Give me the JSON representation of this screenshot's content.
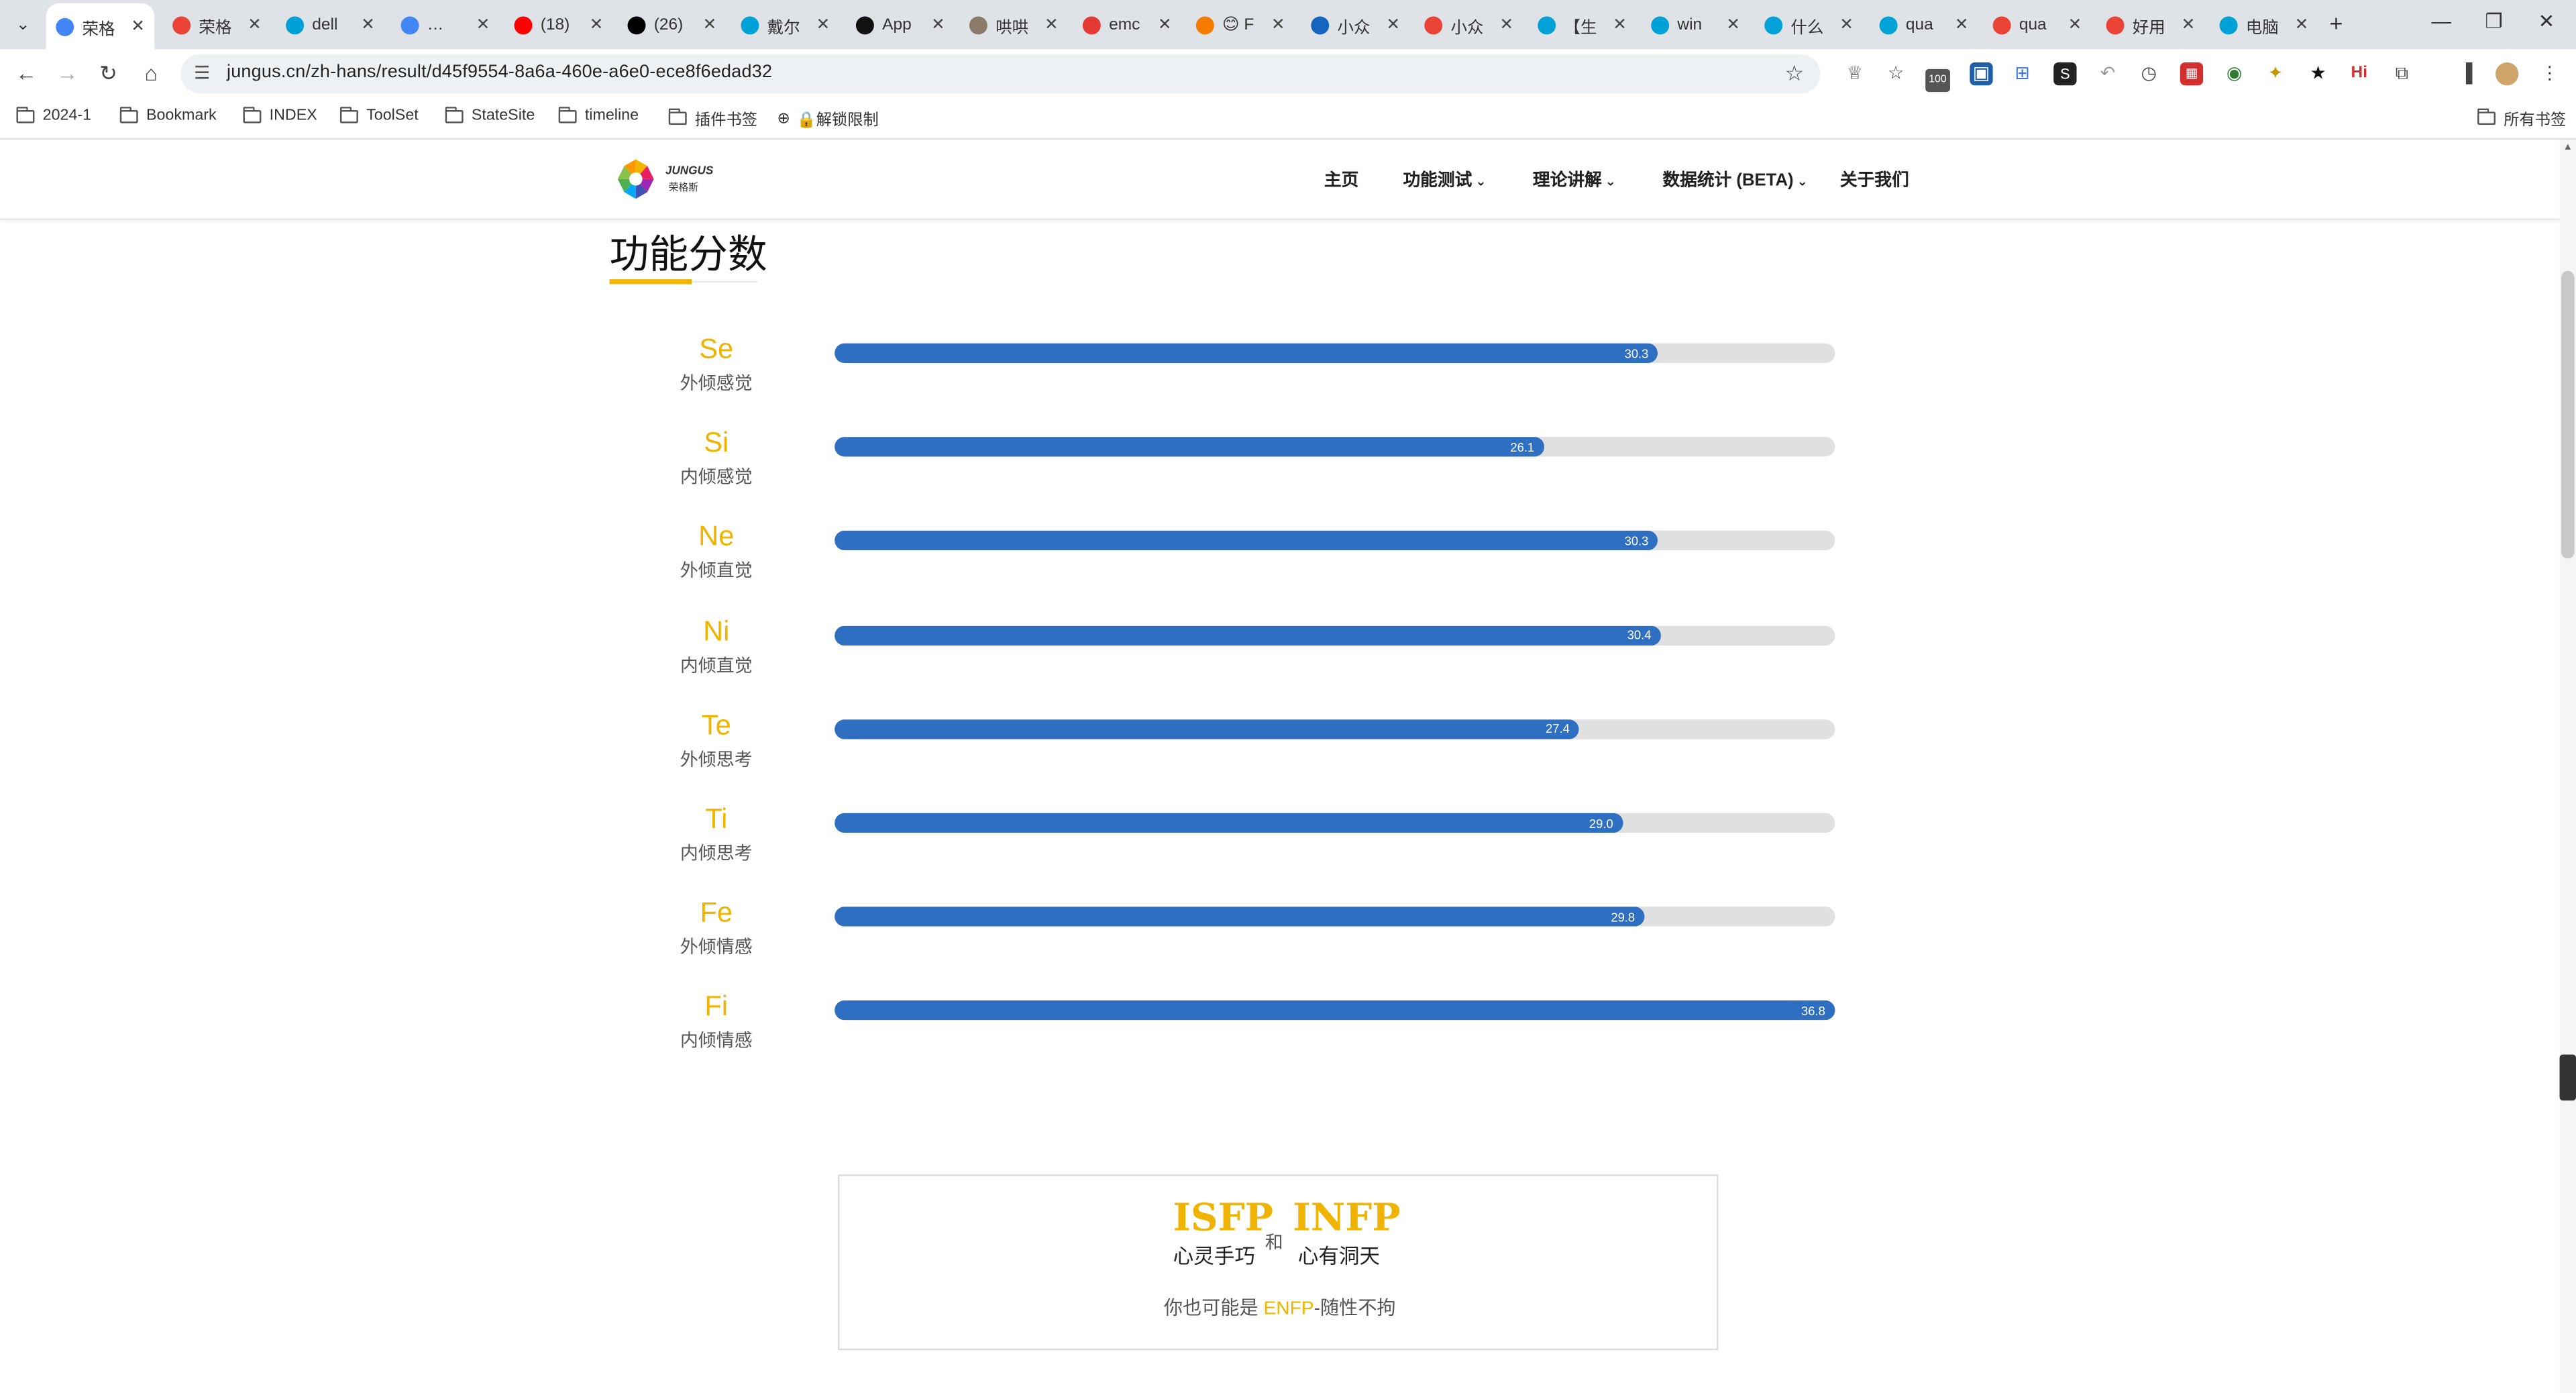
{
  "browser": {
    "tabs": [
      {
        "title": "荣格",
        "active": true,
        "color": "#4285f4",
        "icon": "chrome-icon"
      },
      {
        "title": "荣格",
        "active": false,
        "color": "#ea4335",
        "icon": "google-icon"
      },
      {
        "title": "dell",
        "active": false,
        "color": "#00a1d6",
        "icon": "bilibili-icon"
      },
      {
        "title": "…",
        "active": false,
        "color": "#4285f4",
        "icon": "loading-icon"
      },
      {
        "title": "(18)",
        "active": false,
        "color": "#ff0000",
        "icon": "youtube-icon"
      },
      {
        "title": "(26)",
        "active": false,
        "color": "#000000",
        "icon": "x-icon"
      },
      {
        "title": "戴尔",
        "active": false,
        "color": "#00a1d6",
        "icon": "bilibili-icon"
      },
      {
        "title": "App",
        "active": false,
        "color": "#111111",
        "icon": "github-icon"
      },
      {
        "title": "哄哄",
        "active": false,
        "color": "#8a7a6a",
        "icon": "image-icon"
      },
      {
        "title": "emc",
        "active": false,
        "color": "#e53935",
        "icon": "smile-icon"
      },
      {
        "title": "😊 F",
        "active": false,
        "color": "#f57c00",
        "icon": "shield-icon"
      },
      {
        "title": "小众",
        "active": false,
        "color": "#1565c0",
        "icon": "bookmark-icon"
      },
      {
        "title": "小众",
        "active": false,
        "color": "#ea4335",
        "icon": "google-icon"
      },
      {
        "title": "【生",
        "active": false,
        "color": "#00a1d6",
        "icon": "bilibili-icon"
      },
      {
        "title": "win",
        "active": false,
        "color": "#00a1d6",
        "icon": "bilibili-icon"
      },
      {
        "title": "什么",
        "active": false,
        "color": "#00a1d6",
        "icon": "bilibili-icon"
      },
      {
        "title": "qua",
        "active": false,
        "color": "#00a1d6",
        "icon": "bilibili-icon"
      },
      {
        "title": "qua",
        "active": false,
        "color": "#ea4335",
        "icon": "google-icon"
      },
      {
        "title": "好用",
        "active": false,
        "color": "#ea4335",
        "icon": "google-icon"
      },
      {
        "title": "电脑",
        "active": false,
        "color": "#00a1d6",
        "icon": "bilibili-icon"
      }
    ],
    "url": "jungus.cn/zh-hans/result/d45f9554-8a6a-460e-a6e0-ece8f6edad32",
    "ext_badge": "100",
    "bookmarks": [
      "2024-1",
      "Bookmark",
      "INDEX",
      "ToolSet",
      "StateSite",
      "timeline",
      "插件书签",
      "🔒解锁限制"
    ],
    "all_bookmarks": "所有书签"
  },
  "site": {
    "logo_text": "JUNGUS",
    "logo_sub": "荣格斯",
    "nav": [
      "主页",
      "功能测试",
      "理论讲解",
      "数据统计 (BETA)",
      "关于我们"
    ],
    "section_title": "功能分数"
  },
  "chart_data": {
    "type": "bar",
    "orientation": "horizontal",
    "title": "功能分数",
    "categories": [
      "Se",
      "Si",
      "Ne",
      "Ni",
      "Te",
      "Ti",
      "Fe",
      "Fi"
    ],
    "category_names": [
      "外倾感觉",
      "内倾感觉",
      "外倾直觉",
      "内倾直觉",
      "外倾思考",
      "内倾思考",
      "外倾情感",
      "内倾情感"
    ],
    "values": [
      30.3,
      26.1,
      30.3,
      30.4,
      27.4,
      29.0,
      29.8,
      36.8
    ],
    "value_labels": [
      "30.3",
      "26.1",
      "30.3",
      "30.4",
      "27.4",
      "29.0",
      "29.8",
      "36.8"
    ],
    "xlim": [
      0,
      36.8
    ],
    "colors": {
      "bar": "#2f6fc1",
      "track": "#e0e0e0",
      "label": "#f0b400"
    }
  },
  "result": {
    "type_a": "ISFP",
    "nick_a": "心灵手巧",
    "conj": "和",
    "type_b": "INFP",
    "nick_b": "心有洞天",
    "maybe_prefix": "你也可能是",
    "maybe_type": "ENFP",
    "maybe_suffix": "-随性不拘"
  }
}
